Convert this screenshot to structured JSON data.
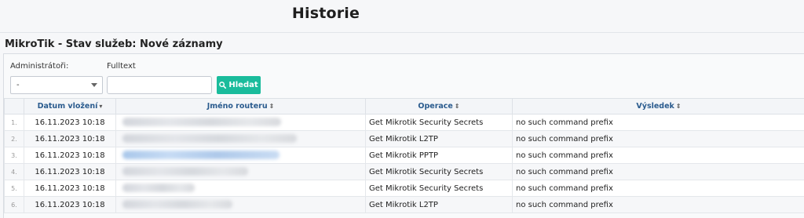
{
  "page": {
    "title": "Historie"
  },
  "panel": {
    "title": "MikroTik - Stav služeb: Nové záznamy"
  },
  "filters": {
    "admin_label": "Administrátoři:",
    "admin_value": "-",
    "fulltext_label": "Fulltext",
    "fulltext_value": "",
    "search_label": "Hledat"
  },
  "table": {
    "columns": {
      "date": "Datum vložení",
      "router": "Jméno routeru",
      "operation": "Operace",
      "result": "Výsledek"
    },
    "rows": [
      {
        "num": "1.",
        "date": "16.11.2023 10:18",
        "operation": "Get Mikrotik Security Secrets",
        "result": "no such command prefix"
      },
      {
        "num": "2.",
        "date": "16.11.2023 10:18",
        "operation": "Get Mikrotik L2TP",
        "result": "no such command prefix"
      },
      {
        "num": "3.",
        "date": "16.11.2023 10:18",
        "operation": "Get Mikrotik PPTP",
        "result": "no such command prefix"
      },
      {
        "num": "4.",
        "date": "16.11.2023 10:18",
        "operation": "Get Mikrotik Security Secrets",
        "result": "no such command prefix"
      },
      {
        "num": "5.",
        "date": "16.11.2023 10:18",
        "operation": "Get Mikrotik Security Secrets",
        "result": "no such command prefix"
      },
      {
        "num": "6.",
        "date": "16.11.2023 10:18",
        "operation": "Get Mikrotik L2TP",
        "result": "no such command prefix"
      }
    ]
  },
  "colors": {
    "accent": "#1abc9c",
    "header_text": "#2a5b8e"
  }
}
